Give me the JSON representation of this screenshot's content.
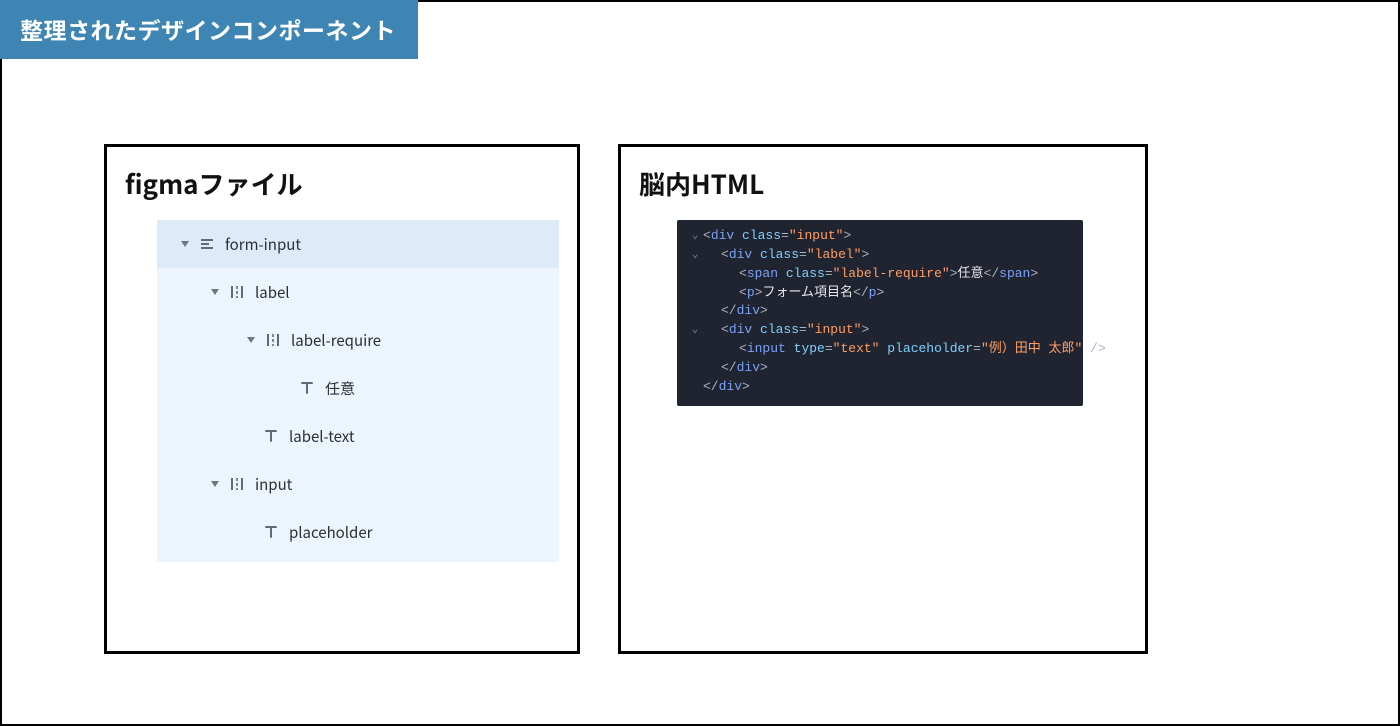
{
  "banner": {
    "title": "整理されたデザインコンポーネント"
  },
  "left_card": {
    "title": "figmaファイル",
    "tree": [
      {
        "indent": 0,
        "hasCaret": true,
        "icon": "text-align",
        "label": "form-input",
        "selected": true
      },
      {
        "indent": 1,
        "hasCaret": true,
        "icon": "frame-h",
        "label": "label",
        "selected": false
      },
      {
        "indent": 2,
        "hasCaret": true,
        "icon": "frame-h",
        "label": "label-require",
        "selected": false
      },
      {
        "indent": 3,
        "hasCaret": false,
        "icon": "text",
        "label": "任意",
        "selected": false
      },
      {
        "indent": 2,
        "hasCaret": false,
        "icon": "text",
        "label": "label-text",
        "selected": false
      },
      {
        "indent": 1,
        "hasCaret": true,
        "icon": "frame-h",
        "label": "input",
        "selected": false
      },
      {
        "indent": 2,
        "hasCaret": false,
        "icon": "text",
        "label": "placeholder",
        "selected": false
      }
    ]
  },
  "right_card": {
    "title": "脳内HTML",
    "code": [
      {
        "caret": "v",
        "indent": 1,
        "tokens": [
          {
            "t": "pun",
            "v": "<"
          },
          {
            "t": "tag",
            "v": "div"
          },
          {
            "t": "pun",
            "v": " "
          },
          {
            "t": "attr",
            "v": "class"
          },
          {
            "t": "pun",
            "v": "="
          },
          {
            "t": "str",
            "v": "\"input\""
          },
          {
            "t": "pun",
            "v": ">"
          }
        ]
      },
      {
        "caret": "v",
        "indent": 2,
        "tokens": [
          {
            "t": "pun",
            "v": "<"
          },
          {
            "t": "tag",
            "v": "div"
          },
          {
            "t": "pun",
            "v": " "
          },
          {
            "t": "attr",
            "v": "class"
          },
          {
            "t": "pun",
            "v": "="
          },
          {
            "t": "str",
            "v": "\"label\""
          },
          {
            "t": "pun",
            "v": ">"
          }
        ]
      },
      {
        "caret": "",
        "indent": 3,
        "tokens": [
          {
            "t": "pun",
            "v": "<"
          },
          {
            "t": "tag",
            "v": "span"
          },
          {
            "t": "pun",
            "v": " "
          },
          {
            "t": "attr",
            "v": "class"
          },
          {
            "t": "pun",
            "v": "="
          },
          {
            "t": "str",
            "v": "\"label-require\""
          },
          {
            "t": "pun",
            "v": ">"
          },
          {
            "t": "text",
            "v": "任意"
          },
          {
            "t": "pun",
            "v": "</"
          },
          {
            "t": "tag",
            "v": "span"
          },
          {
            "t": "pun",
            "v": ">"
          }
        ]
      },
      {
        "caret": "",
        "indent": 3,
        "tokens": [
          {
            "t": "pun",
            "v": "<"
          },
          {
            "t": "tag",
            "v": "p"
          },
          {
            "t": "pun",
            "v": ">"
          },
          {
            "t": "text",
            "v": "フォーム項目名"
          },
          {
            "t": "pun",
            "v": "</"
          },
          {
            "t": "tag",
            "v": "p"
          },
          {
            "t": "pun",
            "v": ">"
          }
        ]
      },
      {
        "caret": "",
        "indent": 2,
        "tokens": [
          {
            "t": "pun",
            "v": "</"
          },
          {
            "t": "tag",
            "v": "div"
          },
          {
            "t": "pun",
            "v": ">"
          }
        ]
      },
      {
        "caret": "v",
        "indent": 2,
        "tokens": [
          {
            "t": "pun",
            "v": "<"
          },
          {
            "t": "tag",
            "v": "div"
          },
          {
            "t": "pun",
            "v": " "
          },
          {
            "t": "attr",
            "v": "class"
          },
          {
            "t": "pun",
            "v": "="
          },
          {
            "t": "str",
            "v": "\"input\""
          },
          {
            "t": "pun",
            "v": ">"
          }
        ]
      },
      {
        "caret": "",
        "indent": 3,
        "tokens": [
          {
            "t": "pun",
            "v": "<"
          },
          {
            "t": "tag",
            "v": "input"
          },
          {
            "t": "pun",
            "v": " "
          },
          {
            "t": "attr",
            "v": "type"
          },
          {
            "t": "pun",
            "v": "="
          },
          {
            "t": "str",
            "v": "\"text\""
          },
          {
            "t": "pun",
            "v": " "
          },
          {
            "t": "attr",
            "v": "placeholder"
          },
          {
            "t": "pun",
            "v": "="
          },
          {
            "t": "str",
            "v": "\"例）田中 太郎\""
          },
          {
            "t": "pun",
            "v": " />"
          }
        ]
      },
      {
        "caret": "",
        "indent": 2,
        "tokens": [
          {
            "t": "pun",
            "v": "</"
          },
          {
            "t": "tag",
            "v": "div"
          },
          {
            "t": "pun",
            "v": ">"
          }
        ]
      },
      {
        "caret": "",
        "indent": 1,
        "tokens": [
          {
            "t": "pun",
            "v": "</"
          },
          {
            "t": "tag",
            "v": "div"
          },
          {
            "t": "pun",
            "v": ">"
          }
        ]
      }
    ]
  }
}
